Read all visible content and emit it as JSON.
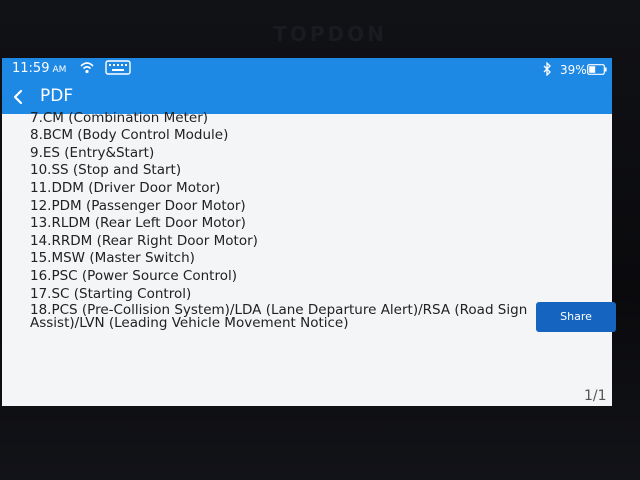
{
  "device": {
    "brand": "TOPDON"
  },
  "status_bar": {
    "time": "11:59",
    "ampm": "AM",
    "battery": "39%",
    "icons": [
      "wifi-icon",
      "keyboard-icon",
      "bluetooth-icon",
      "battery-icon"
    ]
  },
  "header": {
    "back_icon": "back-chevron-icon",
    "title": "PDF"
  },
  "document": {
    "items": [
      "7.CM (Combination Meter)",
      "8.BCM (Body Control Module)",
      "9.ES (Entry&Start)",
      "10.SS (Stop and Start)",
      "11.DDM (Driver Door Motor)",
      "12.PDM (Passenger Door Motor)",
      "13.RLDM (Rear Left Door Motor)",
      "14.RRDM (Rear Right Door Motor)",
      "15.MSW (Master Switch)",
      "16.PSC (Power Source Control)",
      "17.SC (Starting Control)",
      "18.PCS (Pre-Collision System)/LDA (Lane Departure Alert)/RSA (Road Sign Assist)/LVN (Leading Vehicle Movement Notice)"
    ],
    "page_indicator": "1/1"
  },
  "actions": {
    "share_label": "Share"
  },
  "colors": {
    "accent": "#1e88e5",
    "button": "#1565c0",
    "background": "#f4f5f7"
  }
}
